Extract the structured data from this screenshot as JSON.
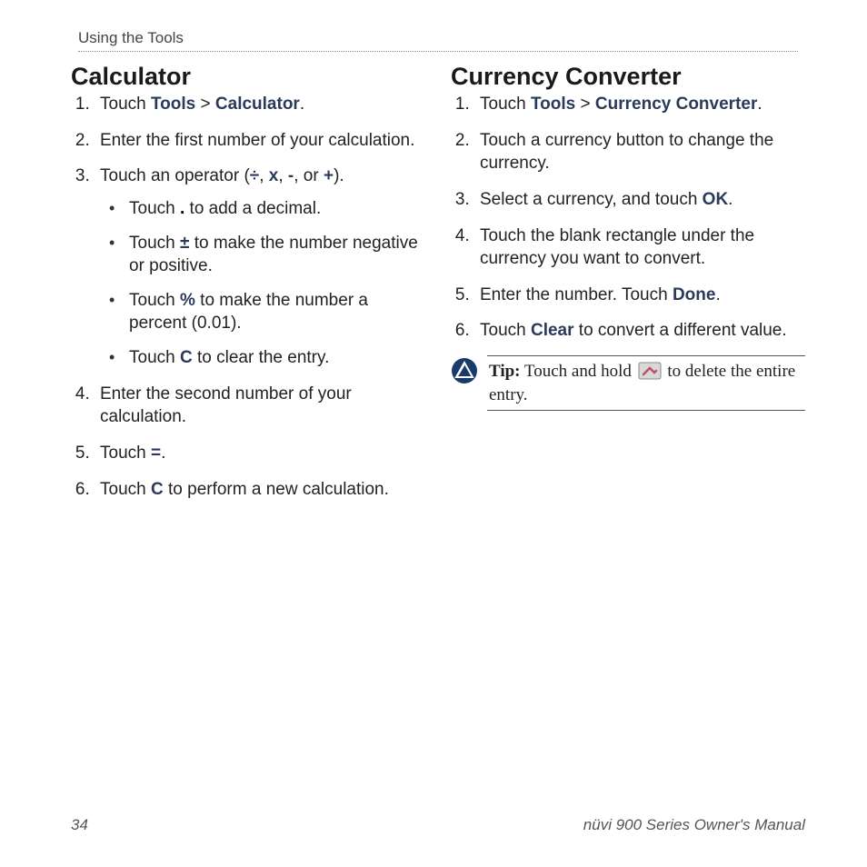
{
  "header": "Using the Tools",
  "left": {
    "heading": "Calculator",
    "step1": {
      "pre": "Touch ",
      "a": "Tools",
      "sep": " > ",
      "b": "Calculator",
      "post": "."
    },
    "step2": "Enter the first number of your calculation.",
    "step3": {
      "pre": "Touch an operator (",
      "o1": "÷",
      "c1": ", ",
      "o2": "x",
      "c2": ", ",
      "o3": "-",
      "c3": ", or ",
      "o4": "+",
      "post": ").",
      "bullets": {
        "b1": {
          "pre": "Touch ",
          "key": ".",
          "post": " to add a decimal."
        },
        "b2": {
          "pre": "Touch ",
          "key": "±",
          "post": " to make the number negative or positive."
        },
        "b3": {
          "pre": "Touch ",
          "key": "%",
          "post": " to make the number a percent (0.01)."
        },
        "b4": {
          "pre": "Touch ",
          "key": "C",
          "post": " to clear the entry."
        }
      }
    },
    "step4": "Enter the second number of your calculation.",
    "step5": {
      "pre": "Touch ",
      "key": "=",
      "post": "."
    },
    "step6": {
      "pre": "Touch ",
      "key": "C",
      "post": " to perform a new calculation."
    }
  },
  "right": {
    "heading": "Currency Converter",
    "step1": {
      "pre": "Touch ",
      "a": "Tools",
      "sep": " > ",
      "b": "Currency Converter",
      "post": "."
    },
    "step2": "Touch a currency button to change the currency.",
    "step3": {
      "pre": "Select a currency, and touch ",
      "key": "OK",
      "post": "."
    },
    "step4": "Touch the blank rectangle under the currency you want to convert.",
    "step5": {
      "pre": "Enter the number. Touch ",
      "key": "Done",
      "post": "."
    },
    "step6": {
      "pre": "Touch ",
      "key": "Clear",
      "post": " to convert a different value."
    },
    "tip": {
      "label": "Tip:",
      "pre": " Touch and hold ",
      "post": " to delete the entire entry."
    }
  },
  "footer": {
    "page": "34",
    "title": "nüvi 900 Series Owner's Manual"
  }
}
